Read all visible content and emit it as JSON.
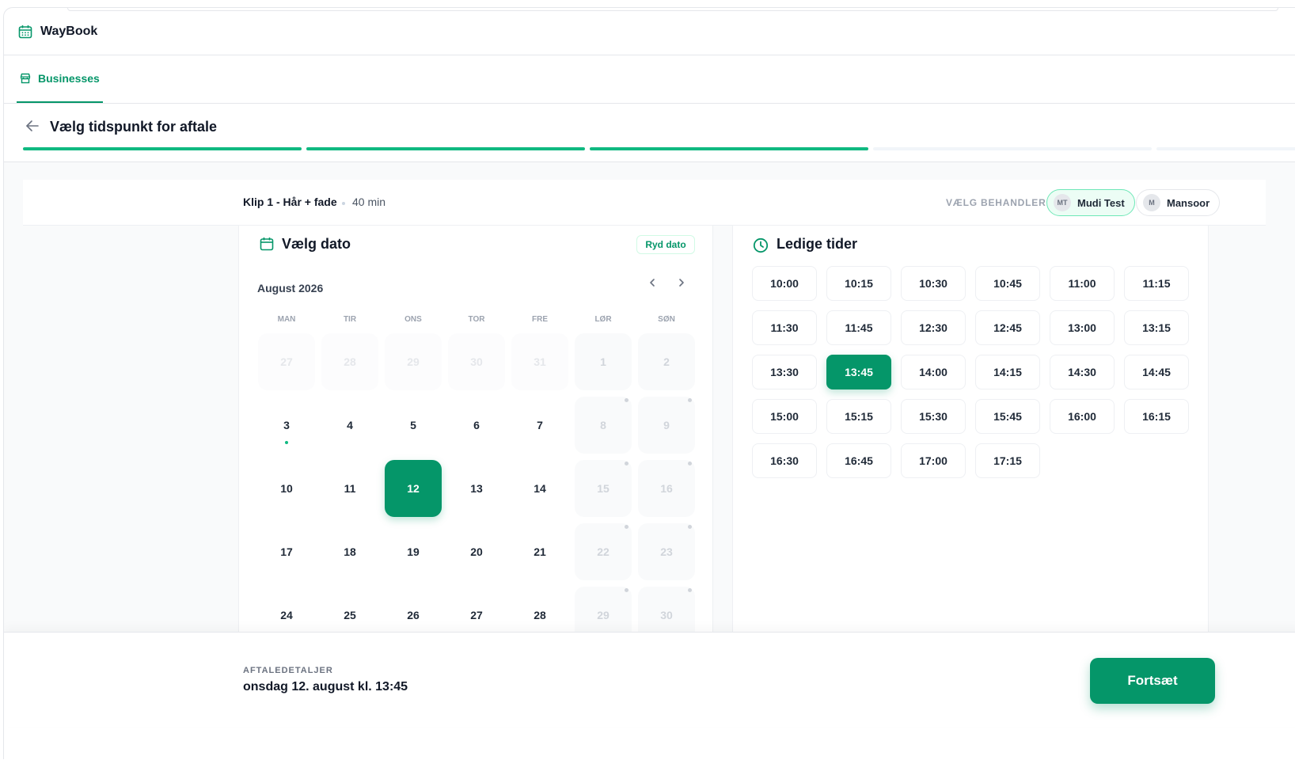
{
  "app": {
    "brand": "WayBook",
    "tab_businesses": "Businesses"
  },
  "step": {
    "title": "Vælg tidspunkt for aftale",
    "segments": 5,
    "completed_segments": 3
  },
  "service": {
    "name": "Klip 1 - Hår + fade",
    "duration": "40 min",
    "pick_staff_label": "VÆLG BEHANDLER:",
    "staff": [
      {
        "initials": "MT",
        "name": "Mudi Test",
        "active": true
      },
      {
        "initials": "M",
        "name": "Mansoor",
        "active": false
      }
    ]
  },
  "calendar": {
    "title": "Vælg dato",
    "clear_label": "Ryd dato",
    "month": "August 2026",
    "weekdays": [
      "MAN",
      "TIR",
      "ONS",
      "TOR",
      "FRE",
      "LØR",
      "SØN"
    ],
    "days": [
      {
        "n": "27",
        "state": "faded"
      },
      {
        "n": "28",
        "state": "faded"
      },
      {
        "n": "29",
        "state": "faded"
      },
      {
        "n": "30",
        "state": "faded"
      },
      {
        "n": "31",
        "state": "faded"
      },
      {
        "n": "1",
        "state": "weekend"
      },
      {
        "n": "2",
        "state": "weekend"
      },
      {
        "n": "3",
        "state": "today"
      },
      {
        "n": "4",
        "state": "normal"
      },
      {
        "n": "5",
        "state": "normal"
      },
      {
        "n": "6",
        "state": "normal"
      },
      {
        "n": "7",
        "state": "normal"
      },
      {
        "n": "8",
        "state": "weekend-dot"
      },
      {
        "n": "9",
        "state": "weekend-dot"
      },
      {
        "n": "10",
        "state": "normal"
      },
      {
        "n": "11",
        "state": "normal"
      },
      {
        "n": "12",
        "state": "selected"
      },
      {
        "n": "13",
        "state": "normal"
      },
      {
        "n": "14",
        "state": "normal"
      },
      {
        "n": "15",
        "state": "weekend-dot"
      },
      {
        "n": "16",
        "state": "weekend-dot"
      },
      {
        "n": "17",
        "state": "normal"
      },
      {
        "n": "18",
        "state": "normal"
      },
      {
        "n": "19",
        "state": "normal"
      },
      {
        "n": "20",
        "state": "normal"
      },
      {
        "n": "21",
        "state": "normal"
      },
      {
        "n": "22",
        "state": "weekend-dot"
      },
      {
        "n": "23",
        "state": "weekend-dot"
      },
      {
        "n": "24",
        "state": "normal"
      },
      {
        "n": "25",
        "state": "normal"
      },
      {
        "n": "26",
        "state": "normal"
      },
      {
        "n": "27",
        "state": "normal"
      },
      {
        "n": "28",
        "state": "normal"
      },
      {
        "n": "29",
        "state": "weekend-dot"
      },
      {
        "n": "30",
        "state": "weekend-dot"
      }
    ]
  },
  "times": {
    "title": "Ledige tider",
    "slots": [
      "10:00",
      "10:15",
      "10:30",
      "10:45",
      "11:00",
      "11:15",
      "11:30",
      "11:45",
      "12:30",
      "12:45",
      "13:00",
      "13:15",
      "13:30",
      "13:45",
      "14:00",
      "14:15",
      "14:30",
      "14:45",
      "15:00",
      "15:15",
      "15:30",
      "15:45",
      "16:00",
      "16:15",
      "16:30",
      "16:45",
      "17:00",
      "17:15"
    ],
    "selected": "13:45"
  },
  "footer": {
    "label": "AFTALEDETALJER",
    "value": "onsdag 12. august kl. 13:45",
    "continue_label": "Fortsæt"
  },
  "colors": {
    "accent": "#059669",
    "accent_light": "#10b981"
  }
}
